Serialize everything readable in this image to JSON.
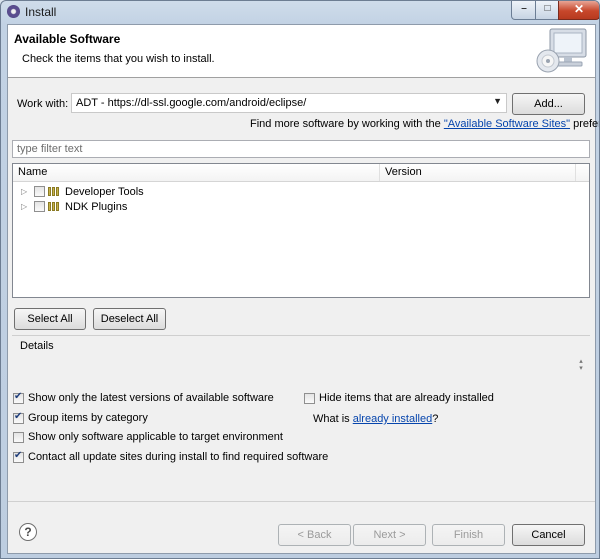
{
  "window": {
    "title": "Install",
    "minimize_glyph": "–",
    "maximize_glyph": "□",
    "close_glyph": "✕"
  },
  "header": {
    "title": "Available Software",
    "description": "Check the items that you wish to install."
  },
  "work_with": {
    "label": "Work with:",
    "value": "ADT - https://dl-ssl.google.com/android/eclipse/",
    "add_button": "Add...",
    "find_more_prefix": "Find more software by working with the ",
    "find_more_link": "\"Available Software Sites\"",
    "find_more_suffix": " preferences."
  },
  "filter": {
    "placeholder": "type filter text",
    "value": ""
  },
  "tree": {
    "columns": [
      "Name",
      "Version"
    ],
    "items": [
      {
        "label": "Developer Tools",
        "checked": false,
        "version": ""
      },
      {
        "label": "NDK Plugins",
        "checked": false,
        "version": ""
      }
    ]
  },
  "selection_buttons": {
    "select_all": "Select All",
    "deselect_all": "Deselect All"
  },
  "details": {
    "label": "Details"
  },
  "options": {
    "latest_versions": {
      "label": "Show only the latest versions of available software",
      "checked": true
    },
    "hide_installed": {
      "label": "Hide items that are already installed",
      "checked": false
    },
    "group_by_category": {
      "label": "Group items by category",
      "checked": true
    },
    "what_is_prefix": "What is ",
    "what_is_link": "already installed",
    "what_is_suffix": "?",
    "target_env": {
      "label": "Show only software applicable to target environment",
      "checked": false
    },
    "contact_sites": {
      "label": "Contact all update sites during install to find required software",
      "checked": true
    }
  },
  "footer": {
    "help_glyph": "?",
    "back": "< Back",
    "next": "Next >",
    "finish": "Finish",
    "cancel": "Cancel"
  },
  "colors": {
    "link": "#0645ad",
    "close_button": "#c7472b",
    "title_gradient": "#cfdcea"
  }
}
